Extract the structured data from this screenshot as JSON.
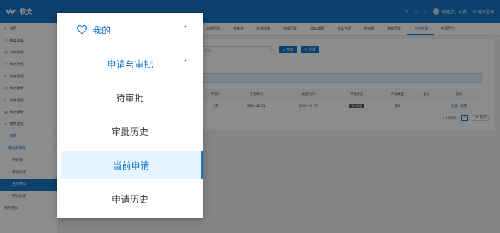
{
  "app": {
    "title": "软文"
  },
  "topbar": {
    "welcome": "欢迎您，小苏",
    "logout": "退出登录"
  },
  "sidebar": {
    "items": [
      {
        "label": "首页",
        "icon": "home-icon",
        "glyph": "⌂"
      },
      {
        "label": "档案收集",
        "icon": "folder-icon",
        "glyph": "▭"
      },
      {
        "label": "归档管理",
        "icon": "file-icon",
        "glyph": "▤"
      },
      {
        "label": "档案管理",
        "icon": "archive-icon",
        "glyph": "▭"
      },
      {
        "label": "利用管理",
        "icon": "filter-icon",
        "glyph": "Y"
      },
      {
        "label": "档案编研",
        "icon": "book-icon",
        "glyph": "▤"
      },
      {
        "label": "库房管理",
        "icon": "warehouse-icon",
        "glyph": "⌂"
      },
      {
        "label": "档案保管",
        "icon": "box-icon",
        "glyph": "▣"
      },
      {
        "label": "档案鉴定",
        "icon": "check-icon",
        "glyph": "◷"
      },
      {
        "label": "我的",
        "icon": "heart-icon",
        "glyph": "♡"
      },
      {
        "label": "申请与审批"
      },
      {
        "label": "待审批"
      },
      {
        "label": "审批历史"
      },
      {
        "label": "当前申请"
      },
      {
        "label": "申请历史"
      },
      {
        "label": "我的借阅"
      }
    ]
  },
  "tabs": [
    "审批列表",
    "待审批",
    "审批提醒",
    "审批历史",
    "档案编研",
    "档案管理",
    "待审批",
    "审批历史",
    "当前申请",
    "申请历史"
  ],
  "content": {
    "search_placeholder": "请输入",
    "query_button": "查询",
    "reset_button": "重置",
    "table": {
      "headers": [
        "申请人",
        "开始时间",
        "结束时间",
        "审批状态",
        "审批类型",
        "备注",
        "操作"
      ],
      "rows": [
        {
          "applicant": "小苏",
          "start": "2020-06-21",
          "end": "2020-06-27",
          "status": "等待审批",
          "type": "借阅",
          "note": "",
          "ops": "查看 · 撤销"
        }
      ]
    },
    "pagination": {
      "summary": "1-1共1条",
      "page": "1",
      "page_size": "10 条/页"
    }
  },
  "dropdown": {
    "my_label": "我的",
    "group_label": "申请与审批",
    "items": [
      "待审批",
      "审批历史",
      "当前申请",
      "申请历史"
    ],
    "selected": "当前申请"
  },
  "colors": {
    "primary": "#1677c9",
    "selected_bg": "#e6f4ff"
  }
}
